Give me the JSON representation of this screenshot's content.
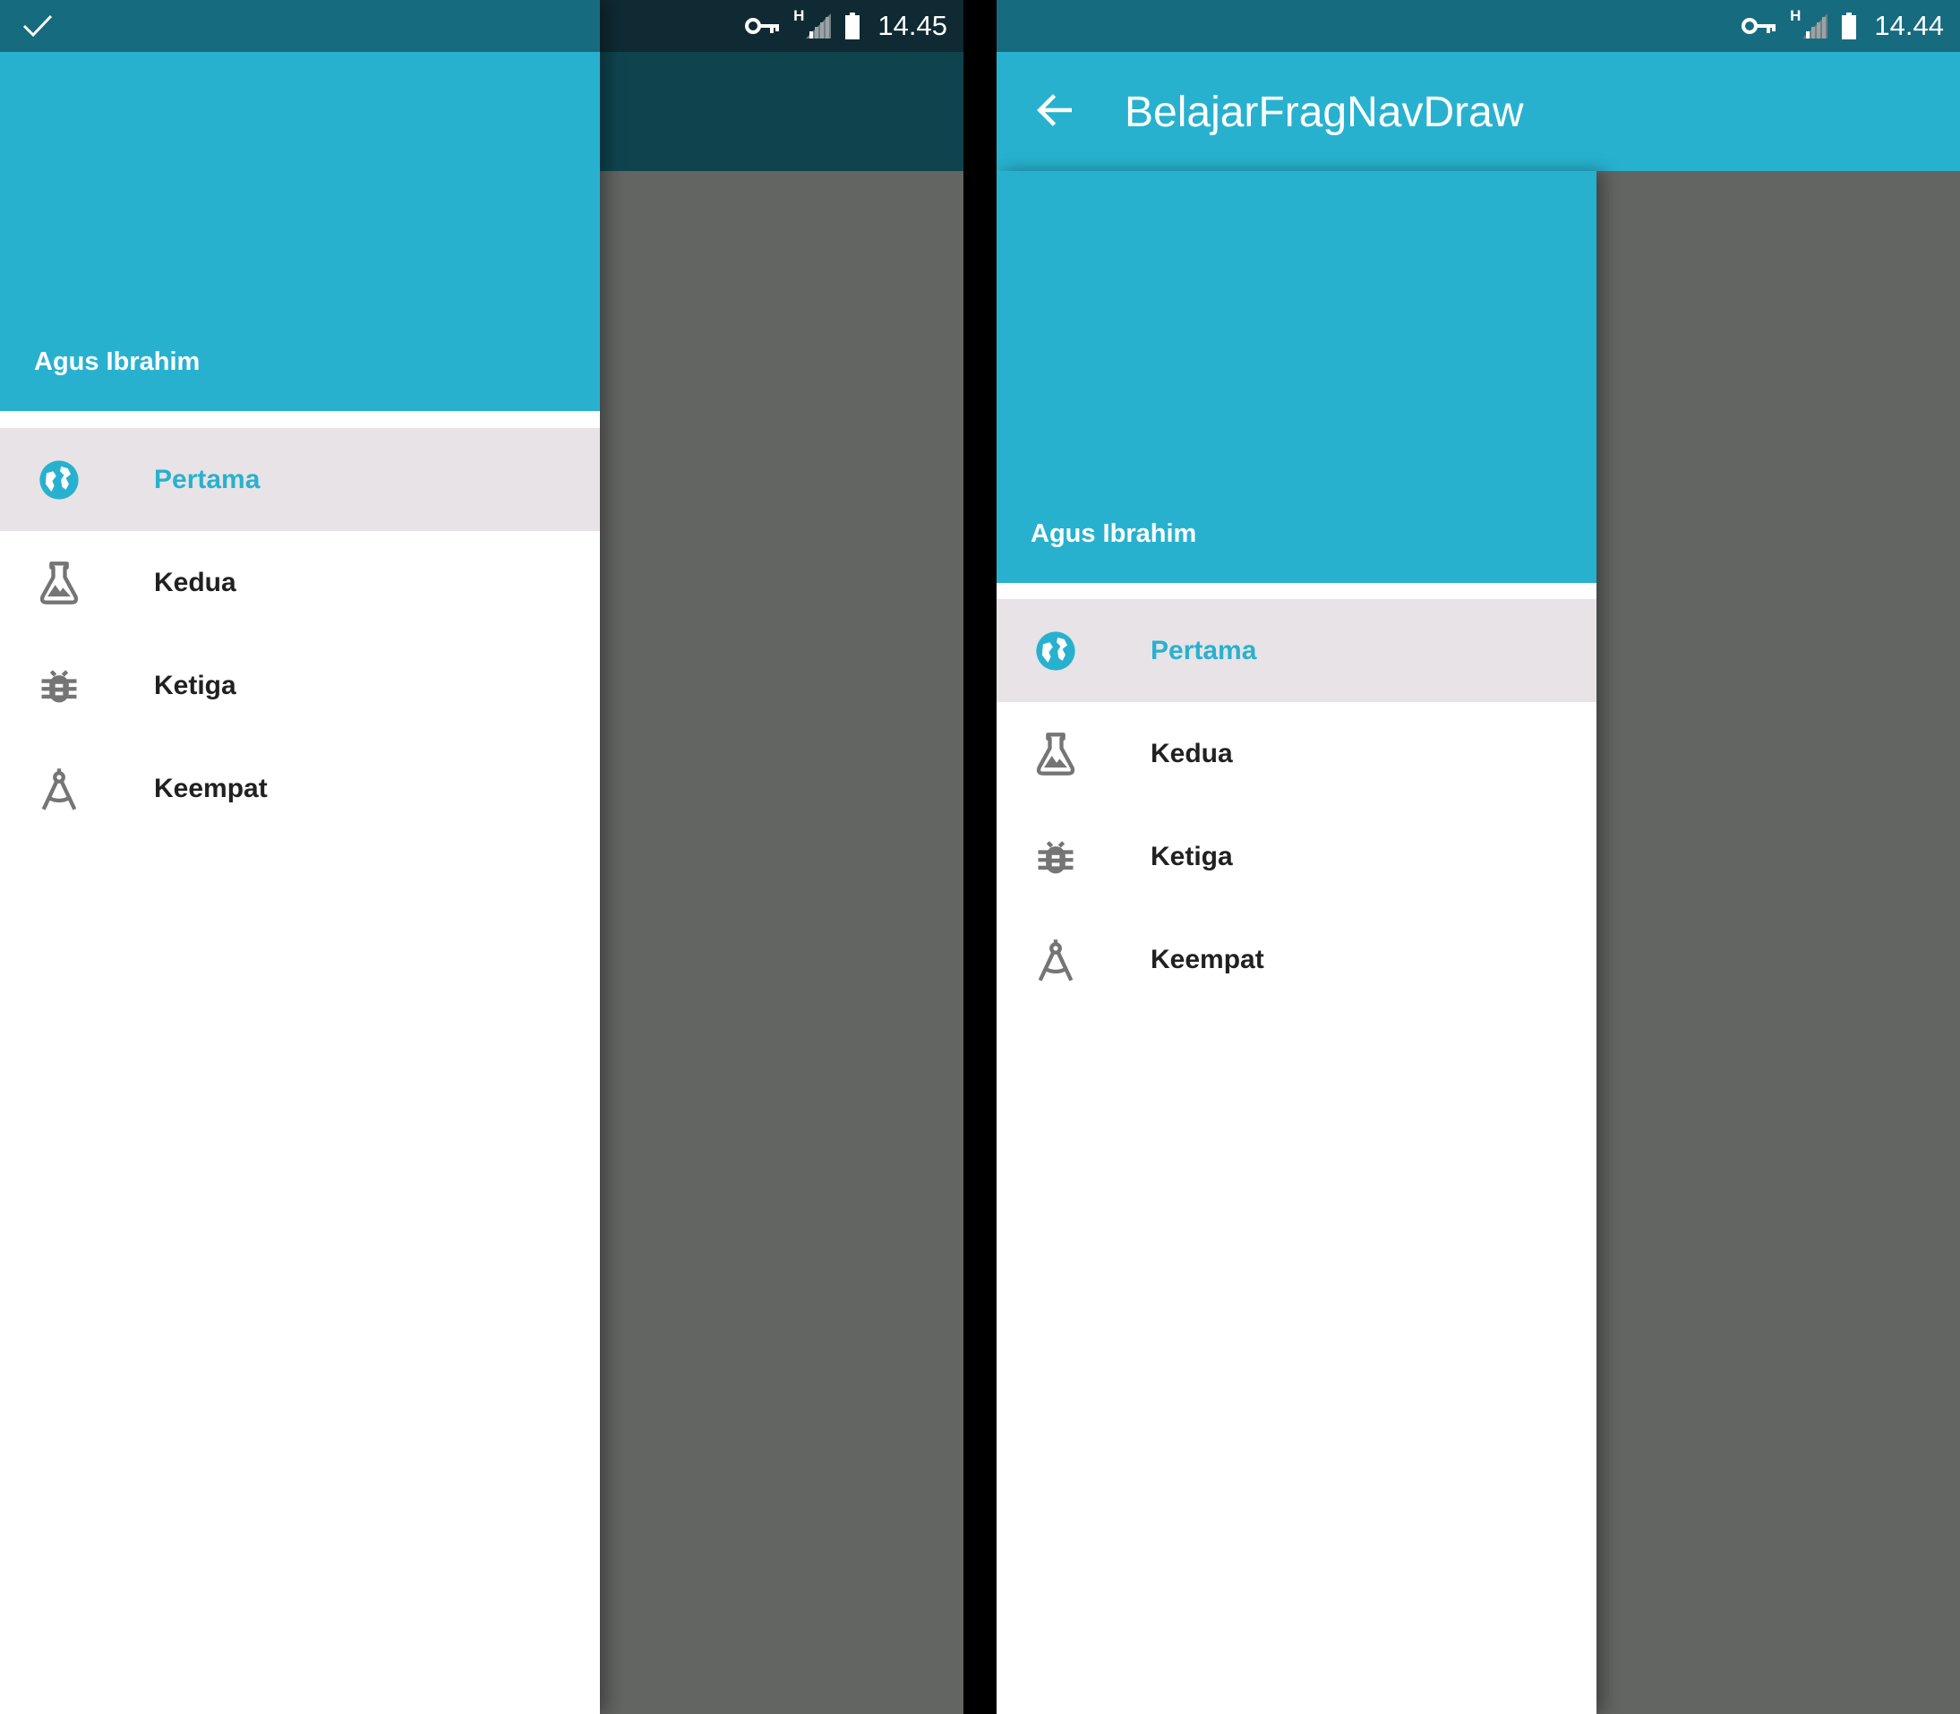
{
  "screen_left": {
    "status_time": "14.45",
    "network_type": "H",
    "header_name": "Agus Ibrahim",
    "menu": [
      {
        "label": "Pertama",
        "icon": "globe-icon",
        "active": true
      },
      {
        "label": "Kedua",
        "icon": "flask-icon",
        "active": false
      },
      {
        "label": "Ketiga",
        "icon": "bug-icon",
        "active": false
      },
      {
        "label": "Keempat",
        "icon": "compass-icon",
        "active": false
      }
    ]
  },
  "screen_right": {
    "status_time": "14.44",
    "network_type": "H",
    "toolbar_title": "BelajarFragNavDraw",
    "header_name": "Agus Ibrahim",
    "menu": [
      {
        "label": "Pertama",
        "icon": "globe-icon",
        "active": true
      },
      {
        "label": "Kedua",
        "icon": "flask-icon",
        "active": false
      },
      {
        "label": "Ketiga",
        "icon": "bug-icon",
        "active": false
      },
      {
        "label": "Keempat",
        "icon": "compass-icon",
        "active": false
      }
    ]
  },
  "colors": {
    "accent": "#28b1cf",
    "status_bar": "#176b7e",
    "scrim": "#636563",
    "active_item_bg": "#e7e3e6",
    "icon_gray": "#757575"
  }
}
